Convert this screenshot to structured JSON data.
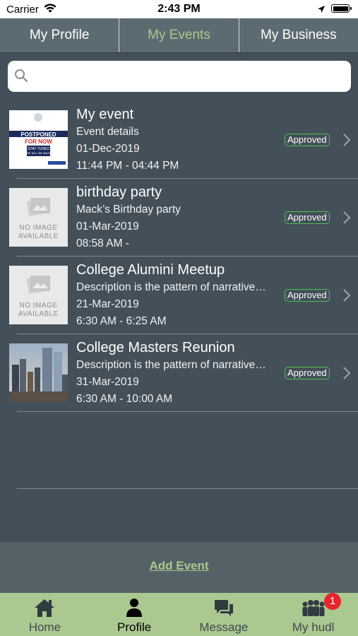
{
  "status_bar": {
    "carrier": "Carrier",
    "time": "2:43 PM"
  },
  "tabs": [
    {
      "label": "My Profile",
      "active": false
    },
    {
      "label": "My Events",
      "active": true
    },
    {
      "label": "My Business",
      "active": false
    }
  ],
  "search": {
    "placeholder": "",
    "value": "",
    "icon": "search-icon"
  },
  "events": [
    {
      "title": "My event",
      "description": "Event details",
      "date": "01-Dec-2019",
      "time": "11:44 PM - 04:44 PM",
      "status": "Approved",
      "thumb_text": [
        "POSTPONED",
        "FOR NOW",
        "STAY TUNED",
        "WE WILL BE BACK"
      ]
    },
    {
      "title": "birthday party",
      "description": "Mack’s Birthday party",
      "date": "01-Mar-2019",
      "time": "08:58 AM -",
      "status": "Approved",
      "thumb_text": [
        "NO IMAGE",
        "AVAILABLE"
      ]
    },
    {
      "title": "College Alumini Meetup",
      "description": "Description is the pattern of narrative…",
      "date": "21-Mar-2019",
      "time": "6:30 AM - 6:25 AM",
      "status": "Approved",
      "thumb_text": [
        "NO IMAGE",
        "AVAILABLE"
      ]
    },
    {
      "title": "College Masters Reunion",
      "description": "Description is the pattern of narrative…",
      "date": "31-Mar-2019",
      "time": "6:30 AM - 10:00 AM",
      "status": "Approved"
    }
  ],
  "add_event_label": "Add Event",
  "tab_bar": [
    {
      "label": "Home",
      "icon": "home-icon",
      "active": false
    },
    {
      "label": "Profile",
      "icon": "profile-icon",
      "active": true
    },
    {
      "label": "Message",
      "icon": "message-icon",
      "active": false
    },
    {
      "label": "My hudl",
      "icon": "group-icon",
      "active": false,
      "badge": "1"
    }
  ],
  "colors": {
    "accent_green": "#a9c98a",
    "approved_border": "#4ec24e",
    "background": "#435059",
    "badge_red": "#e8242c"
  }
}
